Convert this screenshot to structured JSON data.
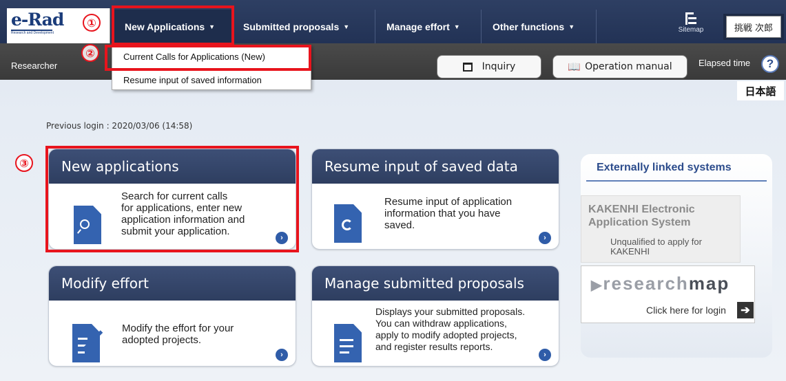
{
  "logo": {
    "text": "e-Rad",
    "sub": "Research and Development"
  },
  "nav": {
    "new_applications": "New Applications",
    "submitted_proposals": "Submitted proposals",
    "manage_effort": "Manage effort",
    "other_functions": "Other functions",
    "sitemap": "Sitemap",
    "username": "挑戦 次郎"
  },
  "subbar": {
    "role": "Researcher",
    "inquiry": "Inquiry",
    "operation_manual": "Operation manual",
    "elapsed_time": "Elapsed time",
    "help": "?",
    "language": "日本語"
  },
  "dropdown": {
    "items": [
      "Current Calls for Applications (New)",
      "Resume input of saved information"
    ]
  },
  "previous_login": "Previous login : 2020/03/06 (14:58)",
  "cards": [
    {
      "title": "New applications",
      "lines": [
        "Search for current calls",
        "for applications, enter new",
        "application information and",
        "submit your application."
      ]
    },
    {
      "title": "Resume input of saved data",
      "lines": [
        "Resume input of application",
        "information that you have",
        "saved."
      ]
    },
    {
      "title": "Modify effort",
      "lines": [
        "Modify the effort for your",
        "adopted projects."
      ]
    },
    {
      "title": "Manage submitted proposals",
      "lines": [
        "Displays your submitted proposals.",
        "You can withdraw applications,",
        "apply to modify adopted projects,",
        "and register results reports."
      ]
    }
  ],
  "side": {
    "title": "Externally linked systems",
    "kakenhi_title_1": "KAKENHI Electronic",
    "kakenhi_title_2": "Application System",
    "kakenhi_note_1": "Unqualified to apply for",
    "kakenhi_note_2": "KAKENHI",
    "rmap_light": "research",
    "rmap_dark": "map",
    "rmap_link": "Click here for login"
  },
  "annotations": {
    "step1": "①",
    "step2": "②",
    "step3": "③"
  },
  "colors": {
    "nav_bg": "#2e3f63",
    "card_head": "#3d4f76",
    "accent_blue": "#3463b0",
    "annotation_red": "#e8141d"
  }
}
